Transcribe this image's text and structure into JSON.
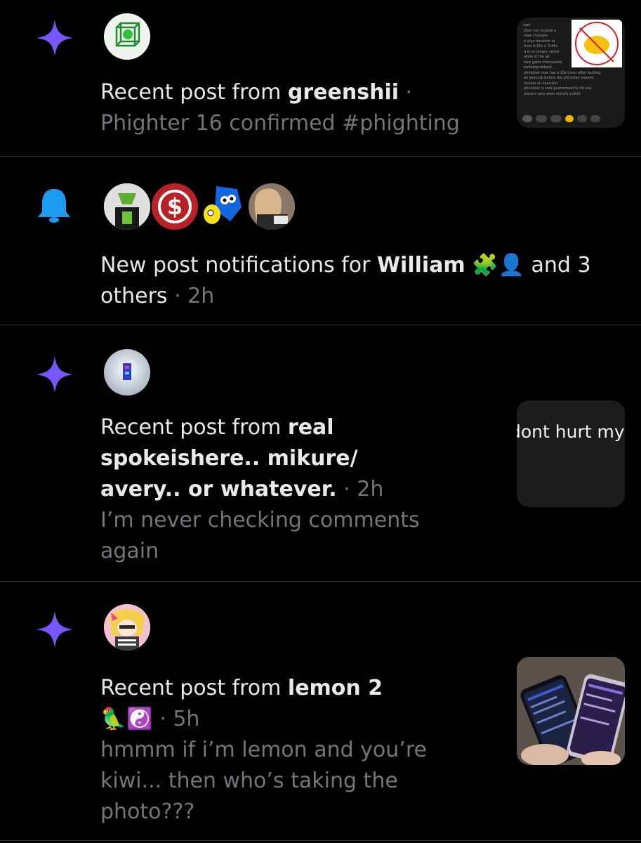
{
  "notifications": [
    {
      "type": "recent-post",
      "prefix": "Recent post from ",
      "name": "greenshii",
      "sep": " ·",
      "snippet": "Phighter 16 confirmed #phighting",
      "thumb_lines": [
        "ban",
        "does not include a",
        "slow changes",
        "e stye duration re",
        "from 0.35s > 0.45s",
        "q is no longer cance",
        "while in the air",
        "now gains immovable",
        "pulled/grabbed)",
        "phinisher now has a 20s timer after landing",
        "an execute before the phinisher expires",
        "(resets on execute)",
        "phinisher is now guaranteed to hit any",
        "players who were initially pulled"
      ]
    },
    {
      "type": "new-post-notifications",
      "prefix": "New post notifications for ",
      "name": "William",
      "emoji": "🧩👤",
      "rest": " and 3",
      "line2": "others",
      "time": "2h"
    },
    {
      "type": "recent-post",
      "prefix": "Recent post from ",
      "name_line1": "real",
      "name_line2": "spokeishere.. mikure/",
      "name_line3": "avery.. or whatever.",
      "time": "2h",
      "snippet_line1": "I’m never checking comments",
      "snippet_line2": "again",
      "thumb_text": "dont hurt my"
    },
    {
      "type": "recent-post",
      "prefix": "Recent post from ",
      "name": "lemon 2",
      "emoji": "🦜☯️",
      "time": "5h",
      "snippet_line1": "hmmm if i’m lemon and you’re",
      "snippet_line2": "kiwi... then who’s taking the",
      "snippet_line3": "photo???"
    }
  ],
  "colors": {
    "accent_purple": "#7856ff",
    "bell_blue": "#1d9bf0"
  }
}
